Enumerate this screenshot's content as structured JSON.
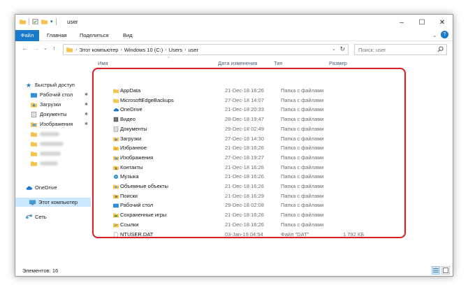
{
  "window": {
    "title": "user",
    "buttons": {
      "minimize": "–",
      "maximize": "☐",
      "close": "✕"
    }
  },
  "ribbon": {
    "tabs": [
      "Файл",
      "Главная",
      "Поделиться",
      "Вид"
    ],
    "expand": "⌄",
    "help": "?"
  },
  "nav": {
    "back": "←",
    "forward": "→",
    "dropdown": "⌄",
    "up": "↑",
    "breadcrumb": [
      "Этот компьютер",
      "Windows 10 (C:)",
      "Users",
      "user"
    ],
    "separator": "›",
    "address_dropdown": "⌄",
    "refresh": "↻",
    "search_placeholder": "Поиск: user"
  },
  "sidebar": {
    "quick_access": "Быстрый доступ",
    "pinned": [
      "Рабочий стол",
      "Загрузки",
      "Документы",
      "Изображения"
    ],
    "pin_glyph": "✱",
    "onedrive": "OneDrive",
    "this_pc": "Этот компьютер",
    "network": "Сеть"
  },
  "columns": {
    "name": "Имя",
    "date": "Дата изменения",
    "type": "Тип",
    "size": "Размер",
    "sort_glyph": "^"
  },
  "files": [
    {
      "name": "AppData",
      "date": "21-Dec-18 16:26",
      "type": "Папка с файлами",
      "size": "",
      "icon": "folder-icon"
    },
    {
      "name": "MicrosoftEdgeBackups",
      "date": "27-Dec-18 14:07",
      "type": "Папка с файлами",
      "size": "",
      "icon": "folder-icon"
    },
    {
      "name": "OneDrive",
      "date": "21-Dec-18 20:33",
      "type": "Папка с файлами",
      "size": "",
      "icon": "cloud-icon"
    },
    {
      "name": "Видео",
      "date": "28-Dec-18 19:47",
      "type": "Папка с файлами",
      "size": "",
      "icon": "video-folder-icon"
    },
    {
      "name": "Документы",
      "date": "29-Dec-18 02:49",
      "type": "Папка с файлами",
      "size": "",
      "icon": "documents-folder-icon"
    },
    {
      "name": "Загрузки",
      "date": "27-Dec-18 14:30",
      "type": "Папка с файлами",
      "size": "",
      "icon": "downloads-folder-icon"
    },
    {
      "name": "Избранное",
      "date": "21-Dec-18 16:26",
      "type": "Папка с файлами",
      "size": "",
      "icon": "favorites-folder-icon"
    },
    {
      "name": "Изображения",
      "date": "27-Dec-18 19:27",
      "type": "Папка с файлами",
      "size": "",
      "icon": "pictures-folder-icon"
    },
    {
      "name": "Контакты",
      "date": "21-Dec-18 16:26",
      "type": "Папка с файлами",
      "size": "",
      "icon": "contacts-folder-icon"
    },
    {
      "name": "Музыка",
      "date": "21-Dec-18 16:26",
      "type": "Папка с файлами",
      "size": "",
      "icon": "music-folder-icon"
    },
    {
      "name": "Объемные объекты",
      "date": "21-Dec-18 16:26",
      "type": "Папка с файлами",
      "size": "",
      "icon": "3d-objects-folder-icon"
    },
    {
      "name": "Поиски",
      "date": "21-Dec-18 16:29",
      "type": "Папка с файлами",
      "size": "",
      "icon": "searches-folder-icon"
    },
    {
      "name": "Рабочий стол",
      "date": "29-Dec-18 02:08",
      "type": "Папка с файлами",
      "size": "",
      "icon": "desktop-folder-icon"
    },
    {
      "name": "Сохраненные игры",
      "date": "21-Dec-18 16:26",
      "type": "Папка с файлами",
      "size": "",
      "icon": "saved-games-folder-icon"
    },
    {
      "name": "Ссылки",
      "date": "21-Dec-18 16:26",
      "type": "Папка с файлами",
      "size": "",
      "icon": "links-folder-icon"
    },
    {
      "name": "NTUSER.DAT",
      "date": "03-Jan-19 04:54",
      "type": "Файл \"DAT\"",
      "size": "1 792 КБ",
      "icon": "file-icon"
    }
  ],
  "status": {
    "count": "Элементов: 16"
  },
  "colors": {
    "accent": "#1979ca",
    "highlight": "#d61f27",
    "folder": "#f4c44e",
    "selected": "#cce8ff"
  }
}
